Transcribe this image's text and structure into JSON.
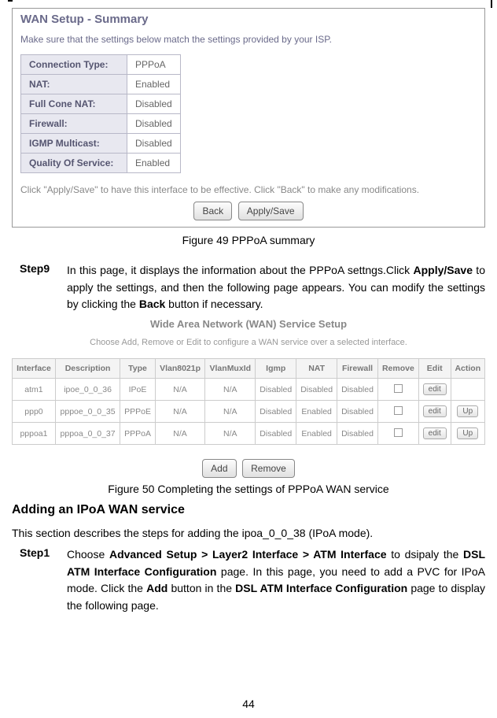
{
  "wan_summary": {
    "title": "WAN Setup - Summary",
    "desc": "Make sure that the settings below match the settings provided by your ISP.",
    "rows": [
      {
        "label": "Connection Type:",
        "value": "PPPoA"
      },
      {
        "label": "NAT:",
        "value": "Enabled"
      },
      {
        "label": "Full Cone NAT:",
        "value": "Disabled"
      },
      {
        "label": "Firewall:",
        "value": "Disabled"
      },
      {
        "label": "IGMP Multicast:",
        "value": "Disabled"
      },
      {
        "label": "Quality Of Service:",
        "value": "Enabled"
      }
    ],
    "footnote": "Click \"Apply/Save\" to have this interface to be effective. Click \"Back\" to make any modifications.",
    "btn_back": "Back",
    "btn_apply": "Apply/Save"
  },
  "fig49": "Figure 49 PPPoA summary",
  "step9": {
    "label": "Step9",
    "pre": "In this page, it displays the information about the PPPoA settngs.Click ",
    "b1": "Apply/Save",
    "mid": " to apply the settings, and then the following page appears. You can modify the settings by clicking the ",
    "b2": "Back",
    "post": " button if necessary."
  },
  "wan_service": {
    "title": "Wide Area Network (WAN) Service Setup",
    "desc": "Choose Add, Remove or Edit to configure a WAN service over a selected interface.",
    "headers": [
      "Interface",
      "Description",
      "Type",
      "Vlan8021p",
      "VlanMuxId",
      "Igmp",
      "NAT",
      "Firewall",
      "Remove",
      "Edit",
      "Action"
    ],
    "rows": [
      {
        "iface": "atm1",
        "desc": "ipoe_0_0_36",
        "type": "IPoE",
        "v8021": "N/A",
        "vmux": "N/A",
        "igmp": "Disabled",
        "nat": "Disabled",
        "fw": "Disabled",
        "edit": "edit",
        "action": ""
      },
      {
        "iface": "ppp0",
        "desc": "pppoe_0_0_35",
        "type": "PPPoE",
        "v8021": "N/A",
        "vmux": "N/A",
        "igmp": "Disabled",
        "nat": "Enabled",
        "fw": "Disabled",
        "edit": "edit",
        "action": "Up"
      },
      {
        "iface": "pppoa1",
        "desc": "pppoa_0_0_37",
        "type": "PPPoA",
        "v8021": "N/A",
        "vmux": "N/A",
        "igmp": "Disabled",
        "nat": "Enabled",
        "fw": "Disabled",
        "edit": "edit",
        "action": "Up"
      }
    ],
    "btn_add": "Add",
    "btn_remove": "Remove"
  },
  "fig50": "Figure 50 Completing the settings of PPPoA WAN service",
  "ipoa_heading": "Adding an IPoA WAN service",
  "ipoa_intro": "This section describes the steps for adding the ipoa_0_0_38 (IPoA mode).",
  "step1": {
    "label": "Step1",
    "t1": "Choose ",
    "b1": "Advanced Setup > Layer2 Interface > ATM Interface",
    "t2": " to dsipaly the ",
    "b2": "DSL ATM Interface Configuration",
    "t3": " page. In this page, you need to add a PVC for IPoA mode. Click the ",
    "b3": "Add",
    "t4": " button in the ",
    "b4": "DSL ATM Interface Configuration",
    "t5": " page to display the following page."
  },
  "page_num": "44"
}
